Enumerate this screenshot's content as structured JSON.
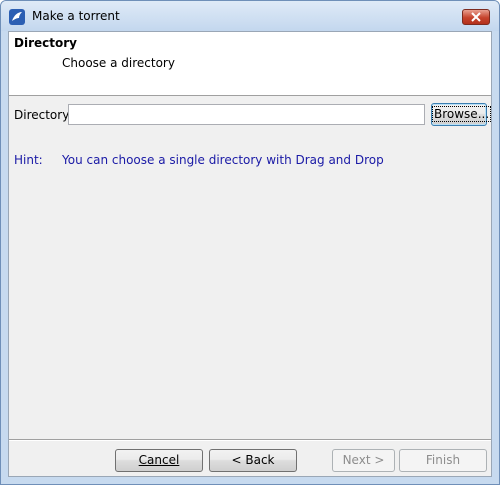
{
  "window": {
    "title": "Make a torrent",
    "icon": "app-bird-icon",
    "close_icon": "close-icon"
  },
  "header": {
    "title": "Directory",
    "subtitle": "Choose a directory"
  },
  "form": {
    "directory_label": "Directory",
    "directory_value": "",
    "browse_label": "Browse..."
  },
  "hint": {
    "label": "Hint:",
    "text": "You can choose a single directory with Drag and Drop",
    "color": "#1a1aa6"
  },
  "footer": {
    "cancel_label": "Cancel",
    "back_label": "< Back",
    "next_label": "Next >",
    "finish_label": "Finish"
  }
}
